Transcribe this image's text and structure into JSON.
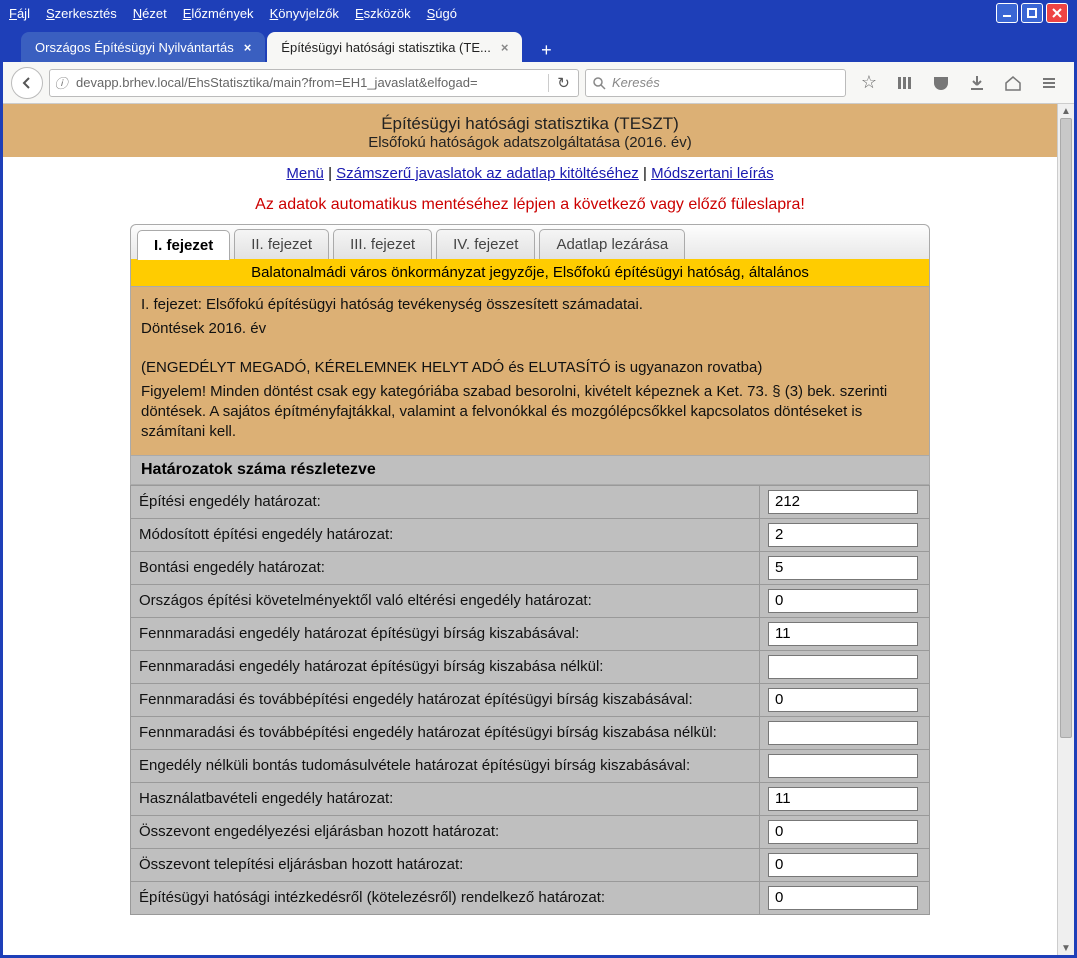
{
  "menubar": [
    "Fájl",
    "Szerkesztés",
    "Nézet",
    "Előzmények",
    "Könyvjelzők",
    "Eszközök",
    "Súgó"
  ],
  "tabs": {
    "inactive_label": "Országos Építésügyi Nyilvántartás",
    "active_label": "Építésügyi hatósági statisztika (TE..."
  },
  "url_value": "devapp.brhev.local/EhsStatisztika/main?from=EH1_javaslat&elfogad=",
  "search_placeholder": "Keresés",
  "banner": {
    "title": "Építésügyi hatósági statisztika (TESZT)",
    "subtitle": "Elsőfokú hatóságok adatszolgáltatása (2016. év)"
  },
  "links": {
    "menu": "Menü",
    "szam": "Számszerű javaslatok az adatlap kitöltéséhez",
    "modsz": "Módszertani leírás"
  },
  "warning": "Az adatok automatikus mentéséhez lépjen a következő vagy előző füleslapra!",
  "inner_tabs": [
    "I. fejezet",
    "II. fejezet",
    "III. fejezet",
    "IV. fejezet",
    "Adatlap lezárása"
  ],
  "yellow": "Balatonalmádi város önkormányzat jegyzője, Elsőfokú építésügyi hatóság, általános",
  "desc": {
    "l1": "I. fejezet: Elsőfokú építésügyi hatóság tevékenység összesített számadatai.",
    "l2": "Döntések 2016. év",
    "l3": "(ENGEDÉLYT MEGADÓ, KÉRELEMNEK HELYT ADÓ és ELUTASÍTÓ is ugyanazon rovatba)",
    "l4": "Figyelem! Minden döntést csak egy kategóriába szabad besorolni, kivételt képeznek a Ket. 73. § (3) bek. szerinti döntések. A sajátos építményfajtákkal, valamint a felvonókkal és mozgólépcsőkkel kapcsolatos döntéseket is számítani kell."
  },
  "section_heading": "Határozatok száma részletezve",
  "rows": [
    {
      "label": "Építési engedély határozat:",
      "value": "212"
    },
    {
      "label": "Módosított építési engedély határozat:",
      "value": "2"
    },
    {
      "label": "Bontási engedély határozat:",
      "value": "5"
    },
    {
      "label": "Országos építési követelményektől való eltérési engedély határozat:",
      "value": "0"
    },
    {
      "label": "Fennmaradási engedély határozat építésügyi bírság kiszabásával:",
      "value": "11"
    },
    {
      "label": "Fennmaradási engedély határozat építésügyi bírság kiszabása nélkül:",
      "value": ""
    },
    {
      "label": "Fennmaradási és továbbépítési engedély határozat építésügyi bírság kiszabásával:",
      "value": "0"
    },
    {
      "label": "Fennmaradási és továbbépítési engedély határozat építésügyi bírság kiszabása nélkül:",
      "value": ""
    },
    {
      "label": "Engedély nélküli bontás tudomásulvétele határozat építésügyi bírság kiszabásával:",
      "value": ""
    },
    {
      "label": "Használatbavételi engedély határozat:",
      "value": "11"
    },
    {
      "label": "Összevont engedélyezési eljárásban hozott határozat:",
      "value": "0"
    },
    {
      "label": "Összevont telepítési eljárásban hozott határozat:",
      "value": "0"
    },
    {
      "label": "Építésügyi hatósági intézkedésről (kötelezésről) rendelkező határozat:",
      "value": "0"
    }
  ]
}
